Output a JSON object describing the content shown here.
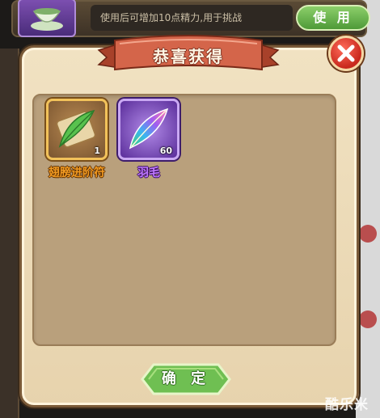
{
  "background": {
    "item_description": "使用后可增加10点精力,用于挑战",
    "use_button_label": "使 用"
  },
  "dialog": {
    "title": "恭喜获得",
    "confirm_label": "确 定",
    "rewards": [
      {
        "name": "翅膀进阶符",
        "count": "1",
        "rarity_color": "#f19a22",
        "icon": "green-feather-scroll-icon"
      },
      {
        "name": "羽毛",
        "count": "60",
        "rarity_color": "#c079ff",
        "icon": "rainbow-feather-icon"
      }
    ]
  },
  "watermark": "酷乐米",
  "colors": {
    "dialog_bg": "#efdfbe",
    "inner_panel": "#b9a07c",
    "banner_red": "#c9553a",
    "confirm_green": "#5fae46",
    "close_red": "#d5352a"
  }
}
